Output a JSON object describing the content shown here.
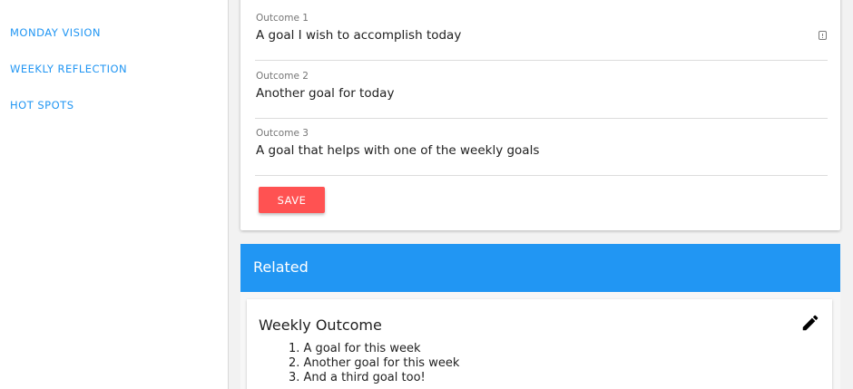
{
  "sidebar": {
    "items": [
      {
        "label": "MONDAY VISION"
      },
      {
        "label": "WEEKLY REFLECTION"
      },
      {
        "label": "HOT SPOTS"
      }
    ]
  },
  "form": {
    "fields": [
      {
        "label": "Outcome 1",
        "value": "A goal I wish to accomplish today"
      },
      {
        "label": "Outcome 2",
        "value": "Another goal for today"
      },
      {
        "label": "Outcome 3",
        "value": "A goal that helps with one of the weekly goals"
      }
    ],
    "save_label": "SAVE"
  },
  "related": {
    "title": "Related",
    "card": {
      "title": "Weekly Outcome",
      "edit_icon": "pencil-icon",
      "goals": [
        "1. A goal for this week",
        "2. Another goal for this week",
        "3. And a third goal too!"
      ]
    }
  },
  "colors": {
    "accent": "#2196f3",
    "save_button": "#ff5252",
    "background": "#f2f2f2"
  }
}
